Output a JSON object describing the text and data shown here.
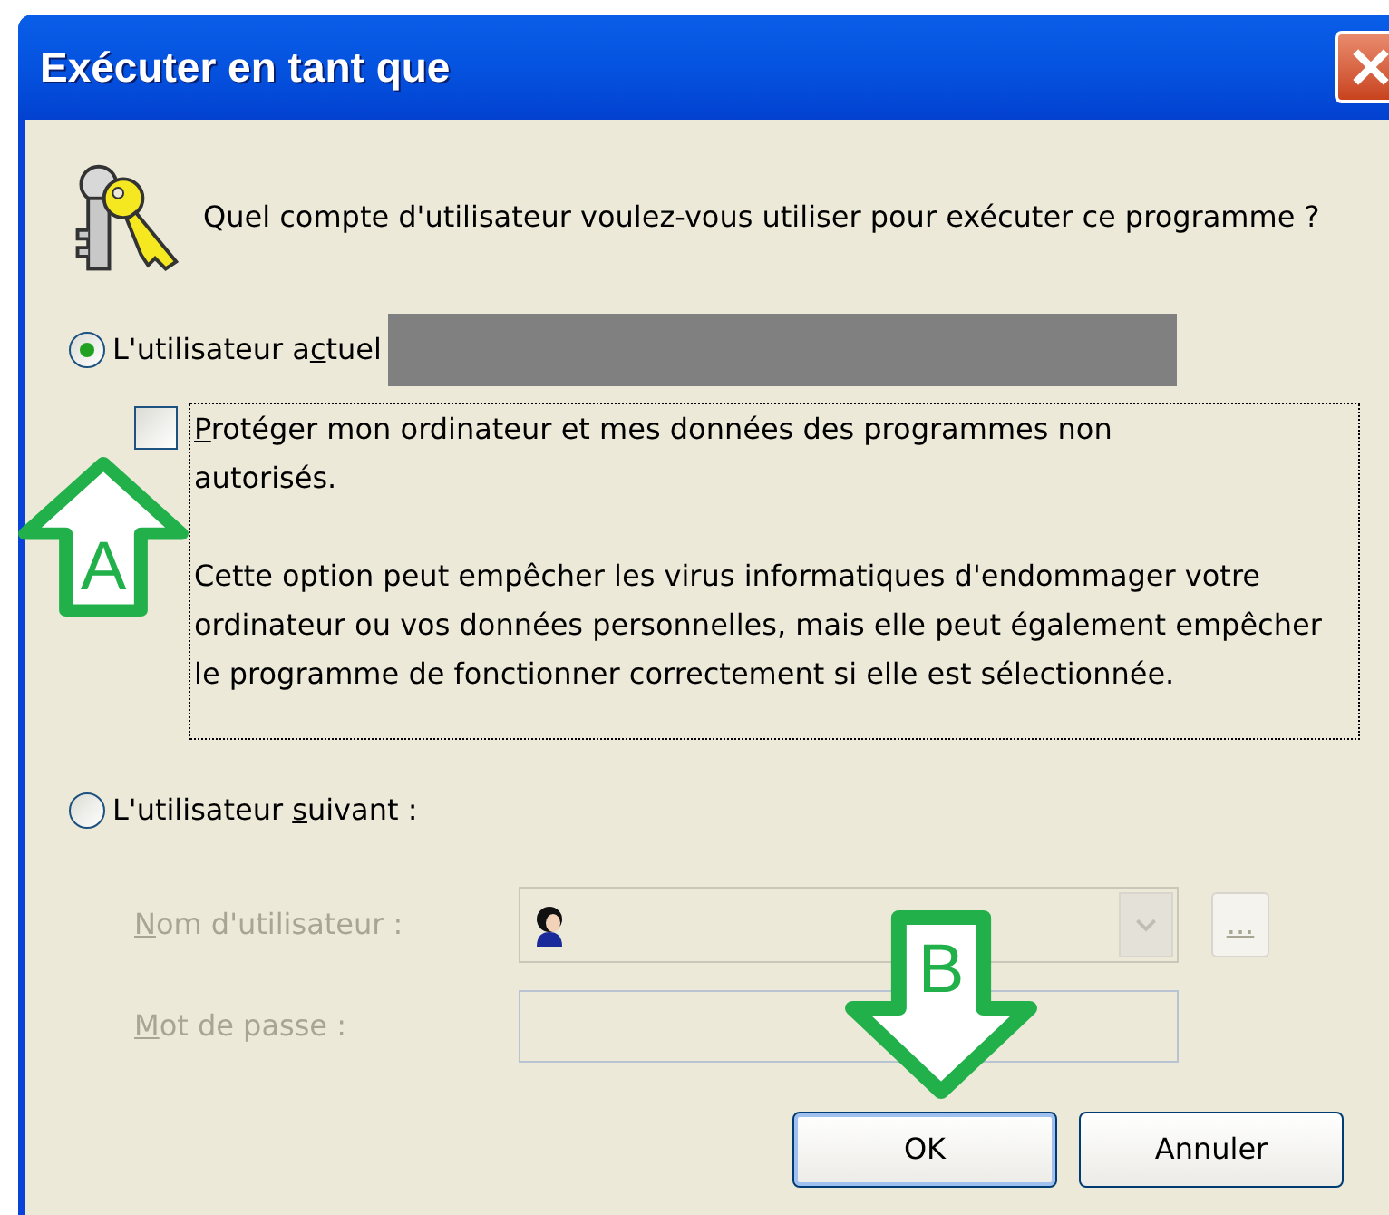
{
  "window": {
    "title": "Exécuter en tant que"
  },
  "question": "Quel compte d'utilisateur voulez-vous utiliser pour exécuter ce programme ?",
  "options": [
    {
      "label": {
        "before": "L'utilisateur a",
        "key": "c",
        "after": "tuel"
      },
      "selected": true,
      "redacted": true
    },
    {
      "label": {
        "before": "L'utilisateur ",
        "key": "s",
        "after": "uivant :"
      },
      "selected": false
    }
  ],
  "protect": {
    "label": {
      "key": "P",
      "after": "rotéger mon ordinateur et mes données des programmes non autorisés."
    },
    "checked": false,
    "note": "Cette option peut empêcher les virus informatiques d'endommager votre ordinateur ou vos données personnelles, mais elle peut également empêcher le programme de fonctionner correctement si elle est sélectionnée."
  },
  "fields": [
    {
      "kind": "combo",
      "label": {
        "key": "N",
        "after": "om d'utilisateur :"
      },
      "disabled": true,
      "browse": "..."
    },
    {
      "kind": "password",
      "label": {
        "key": "M",
        "after": "ot de passe :"
      },
      "disabled": true
    }
  ],
  "buttons": [
    {
      "label": "OK",
      "default": true
    },
    {
      "label": "Annuler",
      "default": false
    }
  ],
  "annotations": [
    {
      "label": "A",
      "kind": "up"
    },
    {
      "label": "B",
      "kind": "down"
    }
  ]
}
